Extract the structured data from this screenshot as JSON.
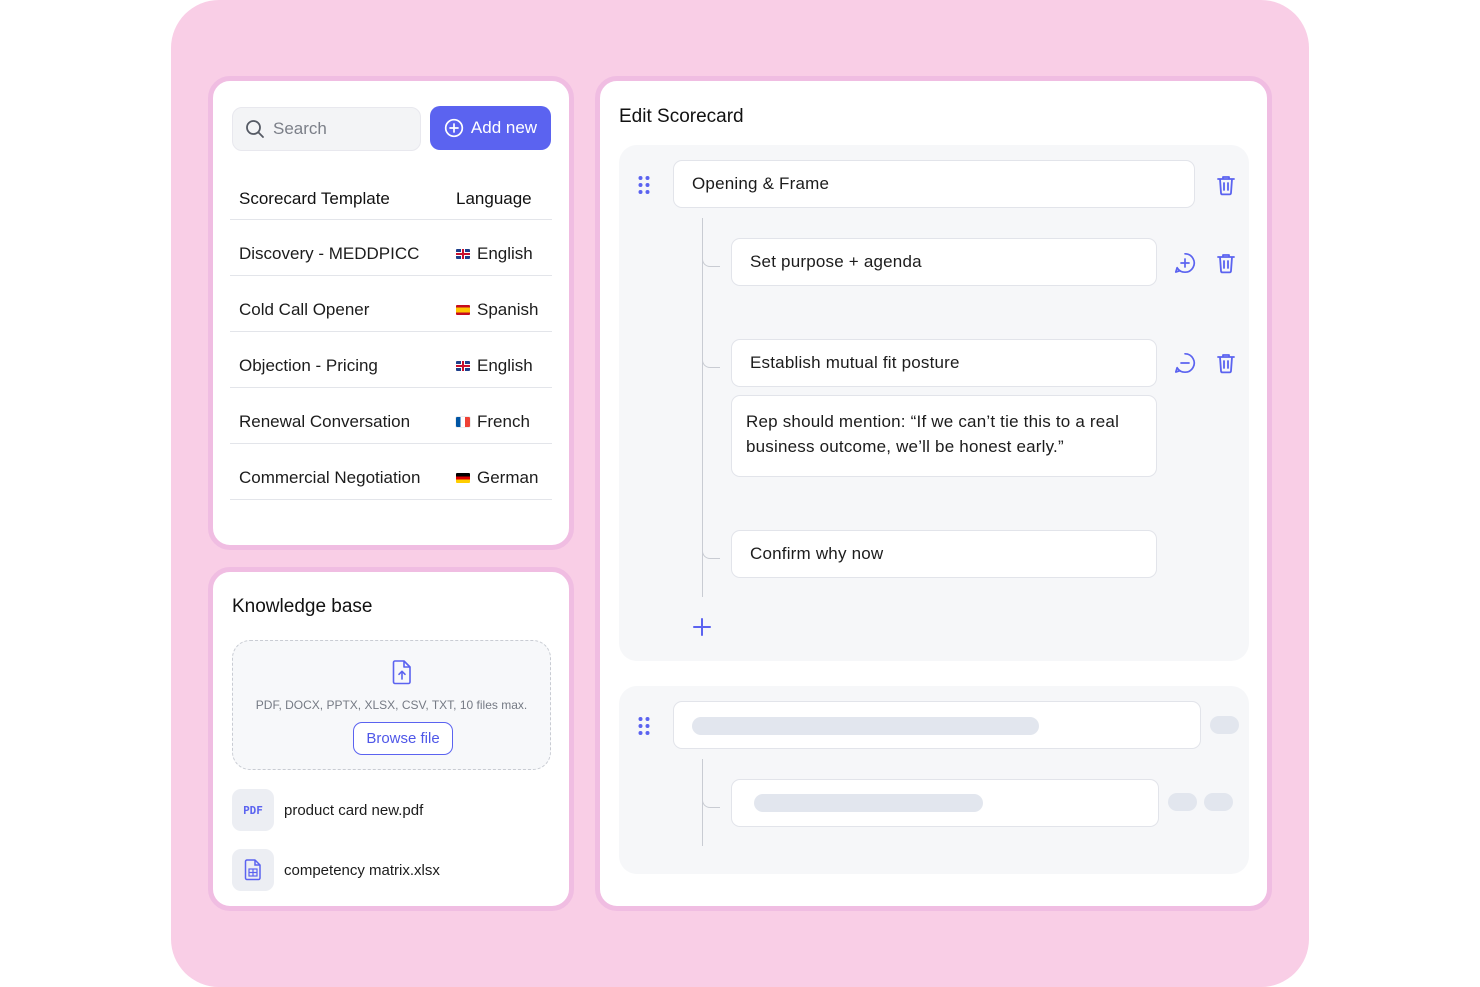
{
  "templates": {
    "search_placeholder": "Search",
    "add_button": "Add new",
    "col_template": "Scorecard Template",
    "col_language": "Language",
    "rows": [
      {
        "name": "Discovery - MEDDPICC",
        "language": "English",
        "flag": "gb"
      },
      {
        "name": "Cold Call Opener",
        "language": "Spanish",
        "flag": "es"
      },
      {
        "name": "Objection - Pricing",
        "language": "English",
        "flag": "gb"
      },
      {
        "name": "Renewal Conversation",
        "language": "French",
        "flag": "fr"
      },
      {
        "name": "Commercial Negotiation",
        "language": "German",
        "flag": "de"
      }
    ]
  },
  "knowledge_base": {
    "title": "Knowledge base",
    "hint": "PDF, DOCX, PPTX, XLSX, CSV, TXT, 10 files max.",
    "browse": "Browse file",
    "files": [
      {
        "badge": "PDF",
        "name": "product card new.pdf",
        "icon": "pdf-icon"
      },
      {
        "badge": "",
        "name": "competency matrix.xlsx",
        "icon": "spreadsheet-icon"
      }
    ]
  },
  "editor": {
    "title": "Edit Scorecard",
    "section_title": "Opening & Frame",
    "items": [
      {
        "label": "Set purpose + agenda"
      },
      {
        "label": "Establish mutual fit posture",
        "note": "Rep should mention: “If we can’t tie this to a real business outcome, we’ll be honest early.”"
      },
      {
        "label": "Confirm why now"
      }
    ]
  },
  "colors": {
    "accent": "#5b63f0",
    "background": "#f9cee6",
    "card_border": "#f0bde2"
  }
}
